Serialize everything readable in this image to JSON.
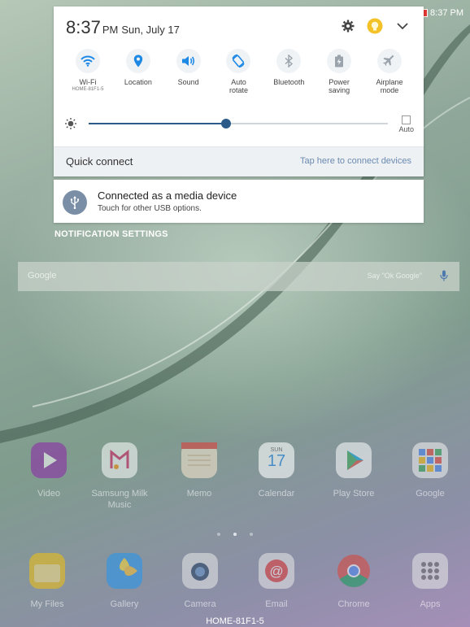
{
  "status_bar": {
    "time": "8:37 PM"
  },
  "panel": {
    "clock_time": "8:37",
    "clock_ampm": "PM",
    "clock_date": "Sun, July 17",
    "toggles": [
      {
        "label": "Wi-Fi",
        "sub": "HOME-81F1-5",
        "icon": "wifi-icon",
        "active": true
      },
      {
        "label": "Location",
        "sub": "",
        "icon": "location-icon",
        "active": true
      },
      {
        "label": "Sound",
        "sub": "",
        "icon": "sound-icon",
        "active": true
      },
      {
        "label": "Auto\nrotate",
        "sub": "",
        "icon": "rotate-icon",
        "active": true
      },
      {
        "label": "Bluetooth",
        "sub": "",
        "icon": "bluetooth-icon",
        "active": false
      },
      {
        "label": "Power\nsaving",
        "sub": "",
        "icon": "battery-icon",
        "active": false
      },
      {
        "label": "Airplane\nmode",
        "sub": "",
        "icon": "airplane-icon",
        "active": false
      }
    ],
    "brightness": {
      "level": 0.46,
      "auto_label": "Auto"
    },
    "quick_connect": {
      "title": "Quick connect",
      "hint": "Tap here to connect devices"
    },
    "accent": "#1e88e5",
    "slider_color": "#2c5b8a"
  },
  "usb_notification": {
    "title": "Connected as a media device",
    "subtitle": "Touch for other USB options."
  },
  "notification_settings": "NOTIFICATION SETTINGS",
  "google_bar": {
    "logo": "Google",
    "hint": "Say \"Ok Google\""
  },
  "apps_row1": [
    {
      "name": "Video",
      "icon": "video-icon",
      "color": "#8e24aa"
    },
    {
      "name": "Samsung Milk\nMusic",
      "icon": "milk-music-icon",
      "color": "#ffffff"
    },
    {
      "name": "Memo",
      "icon": "memo-icon",
      "color": "#f6b26b"
    },
    {
      "name": "Calendar",
      "icon": "calendar-icon",
      "color": "#ffffff",
      "day": "SUN",
      "num": "17"
    },
    {
      "name": "Play Store",
      "icon": "play-store-icon",
      "color": "#ffffff"
    },
    {
      "name": "Google",
      "icon": "google-folder-icon",
      "color": "#ffffff"
    }
  ],
  "apps_row2": [
    {
      "name": "My Files",
      "icon": "folder-icon",
      "color": "#f4c20d"
    },
    {
      "name": "Gallery",
      "icon": "gallery-icon",
      "color": "#2196f3"
    },
    {
      "name": "Camera",
      "icon": "camera-icon",
      "color": "#e8e8e8"
    },
    {
      "name": "Email",
      "icon": "email-icon",
      "color": "#e53935"
    },
    {
      "name": "Chrome",
      "icon": "chrome-icon",
      "color": "#4caf50"
    },
    {
      "name": "Apps",
      "icon": "apps-grid-icon",
      "color": "#e8e8e8"
    }
  ],
  "network_name": "HOME-81F1-5"
}
